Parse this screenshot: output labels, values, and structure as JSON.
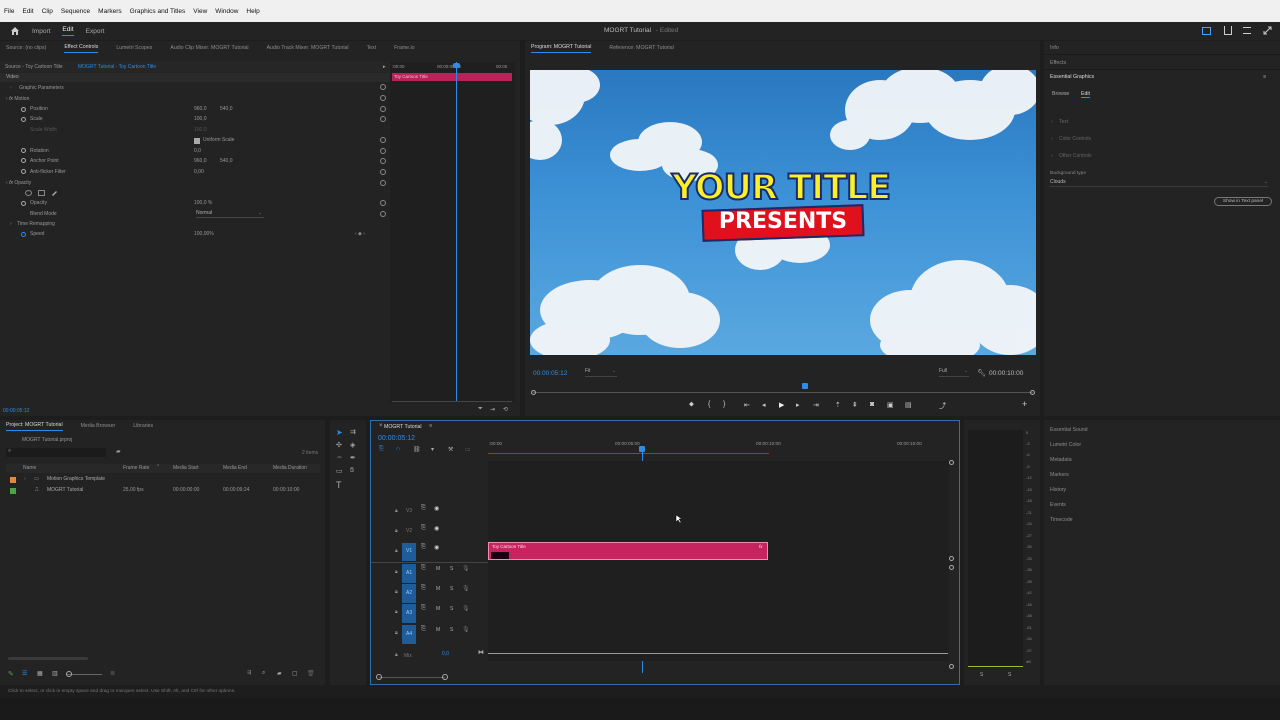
{
  "menu": [
    "File",
    "Edit",
    "Clip",
    "Sequence",
    "Markers",
    "Graphics and Titles",
    "View",
    "Window",
    "Help"
  ],
  "workspace_tabs": {
    "import": "Import",
    "edit": "Edit",
    "export": "Export"
  },
  "app_title": "MOGRT Tutorial",
  "app_title_suffix": "- Edited",
  "effect_controls": {
    "tabs": [
      "Source: (no clips)",
      "Effect Controls",
      "Lumetri Scopes",
      "Audio Clip Mixer: MOGRT Tutorial",
      "Audio Track Mixer: MOGRT Tutorial",
      "Text",
      "Frame.io"
    ],
    "source_label": "Source - Toy Cartoon Title",
    "clip_label": "MOGRT Tutorial - Toy Cartoon Title",
    "video_header": "Video",
    "timeline_start": ":00:00",
    "timeline_mid": "00:00:05:00",
    "timeline_end": "00:00",
    "clip_bar_label": "Toy Cartoon Title",
    "rows": {
      "graphic_parameters": "Graphic Parameters",
      "motion": "Motion",
      "position": "Position",
      "position_x": "960,0",
      "position_y": "540,0",
      "scale": "Scale",
      "scale_val": "100,0",
      "scale_width": "Scale Width",
      "scale_width_val": "100,0",
      "uniform_scale": "Uniform Scale",
      "rotation": "Rotation",
      "rotation_val": "0,0",
      "anchor_point": "Anchor Point",
      "anchor_x": "960,0",
      "anchor_y": "540,0",
      "anti_flicker": "Anti-flicker Filter",
      "anti_flicker_val": "0,00",
      "opacity_group": "Opacity",
      "opacity": "Opacity",
      "opacity_val": "100,0 %",
      "blend_mode": "Blend Mode",
      "blend_mode_val": "Normal",
      "time_remapping": "Time Remapping",
      "speed": "Speed",
      "speed_val": "100,00%"
    },
    "footer_timecode": "00:00:05:12"
  },
  "program": {
    "tabs": [
      "Program: MOGRT Tutorial",
      "Reference: MOGRT Tutorial"
    ],
    "title_line1": "YOUR TITLE",
    "title_line2": "PRESENTS",
    "timecode": "00:00:05:12",
    "fit": "Fit",
    "quality": "Full",
    "duration": "00:00:10:00"
  },
  "right_panel": {
    "info": "Info",
    "effects": "Effects",
    "essential_graphics": "Essential Graphics",
    "browse": "Browse",
    "edit": "Edit",
    "sections": [
      "Text",
      "Color Controls",
      "Other Controls"
    ],
    "background_type_label": "Background type",
    "background_type_val": "Clouds",
    "show_text_panel": "Show in Text panel",
    "lower_items": [
      "Essential Sound",
      "Lumetri Color",
      "Metadata",
      "Markers",
      "History",
      "Events",
      "Timecode"
    ]
  },
  "project": {
    "tabs": [
      "Project: MOGRT Tutorial",
      "Media Browser",
      "Libraries"
    ],
    "file": "MOGRT Tutorial.prproj",
    "item_count": "2 items",
    "columns": [
      "Name",
      "Frame Rate",
      "Media Start",
      "Media End",
      "Media Duration"
    ],
    "items": [
      {
        "name": "Motion Graphics Template",
        "fps": "",
        "start": "",
        "end": "",
        "dur": "",
        "color": "#e08a3c"
      },
      {
        "name": "MOGRT Tutorial",
        "fps": "25,00 fps",
        "start": "00:00:00:00",
        "end": "00:00:09:24",
        "dur": "00:00:10:00",
        "color": "#4fa34a"
      }
    ]
  },
  "timeline": {
    "tab": "MOGRT Tutorial",
    "timecode": "00:00:05:12",
    "ruler": [
      ":00:00",
      "00:00:05:00",
      "00:00:10:00",
      "00:00:15:00"
    ],
    "video_tracks": [
      "V3",
      "V2",
      "V1"
    ],
    "audio_tracks": [
      "A1",
      "A2",
      "A3",
      "A4"
    ],
    "mix": "Mix",
    "mix_val": "0,0",
    "clip_label": "Toy Cartoon Title",
    "m": "M",
    "s": "S"
  },
  "meter_scale": [
    "0",
    "-3",
    "-6",
    "-9",
    "-12",
    "-15",
    "-18",
    "-21",
    "-24",
    "-27",
    "-30",
    "-33",
    "-36",
    "-39",
    "-42",
    "-45",
    "-48",
    "-51",
    "-54",
    "-57",
    "dB"
  ],
  "meter_ss": [
    "S",
    "S"
  ],
  "status_bar": "Click to select, or click in empty space and drag to marquee select. Use Shift, Alt, and Ctrl for other options.",
  "colors": {
    "accent": "#2d8ceb",
    "clip": "#c6245e",
    "panel": "#232323",
    "bg": "#1d1d1d"
  }
}
